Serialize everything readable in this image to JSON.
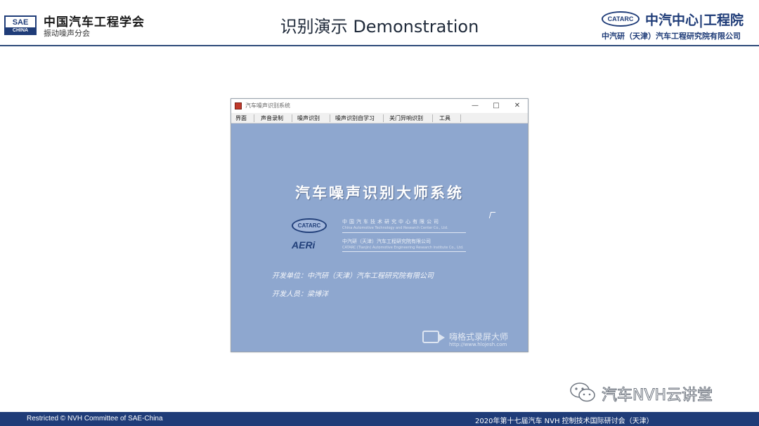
{
  "header": {
    "sae_logo_top": "SAE",
    "sae_logo_bottom": "CHINA",
    "org_name": "中国汽车工程学会",
    "org_sub": "振动噪声分会",
    "title": "识别演示 Demonstration",
    "catarc_logo": "CATARC",
    "catarc_name": "中汽中心|工程院",
    "catarc_sub": "中汽研（天津）汽车工程研究院有限公司"
  },
  "app": {
    "window_title": "汽车噪声识别系统",
    "controls": {
      "minimize": "—",
      "maximize": "□",
      "close": "✕"
    },
    "menu": [
      "界面",
      "声音录制",
      "噪声识别",
      "噪声识别自学习",
      "关门异响识别",
      "工具"
    ],
    "heading": "汽车噪声识别大师系统",
    "logo1": "CATARC",
    "logo2": "AERi",
    "company1_cn": "中国汽车技术研究中心有限公司",
    "company1_en": "China Automotive Technology and Research Center Co., Ltd.",
    "company2_cn": "中汽研（天津）汽车工程研究院有限公司",
    "company2_en": "CATARC (Tianjin) Automotive Engineering Research Institute Co., Ltd.",
    "dev_unit": "开发单位：中汽研（天津）汽车工程研究院有限公司",
    "dev_person": "开发人员：梁博洋"
  },
  "watermark": {
    "recorder_name": "嗨格式录屏大师",
    "recorder_url": "http://www.hlojesh.com",
    "wechat": "汽车NVH云讲堂"
  },
  "footer": {
    "left": "Restricted © NVH Committee of SAE-China",
    "right": "2020年第十七届汽车 NVH 控制技术国际研讨会（天津）"
  },
  "colors": {
    "brand_blue": "#1f3c78",
    "app_background": "#8ea7cf"
  }
}
